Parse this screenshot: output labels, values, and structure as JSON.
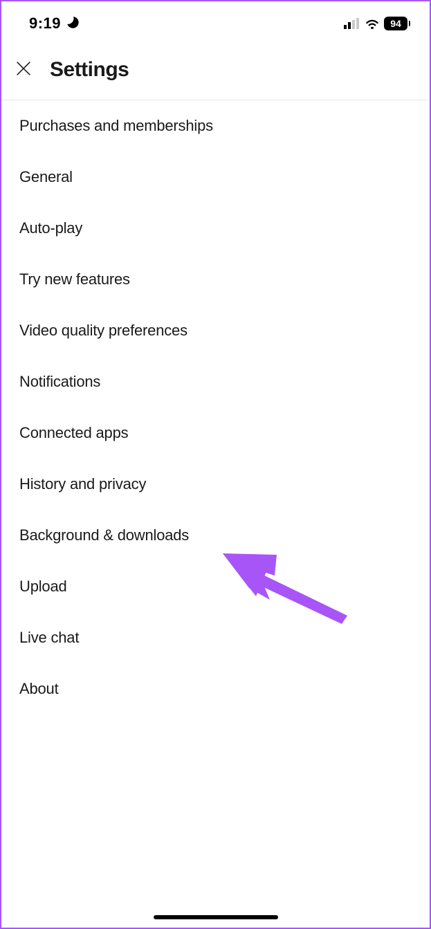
{
  "status": {
    "time": "9:19",
    "battery": "94"
  },
  "header": {
    "title": "Settings"
  },
  "settings": {
    "items": [
      {
        "label": "Purchases and memberships"
      },
      {
        "label": "General"
      },
      {
        "label": "Auto-play"
      },
      {
        "label": "Try new features"
      },
      {
        "label": "Video quality preferences"
      },
      {
        "label": "Notifications"
      },
      {
        "label": "Connected apps"
      },
      {
        "label": "History and privacy"
      },
      {
        "label": "Background & downloads"
      },
      {
        "label": "Upload"
      },
      {
        "label": "Live chat"
      },
      {
        "label": "About"
      }
    ]
  },
  "annotation": {
    "color": "#a855f7"
  }
}
